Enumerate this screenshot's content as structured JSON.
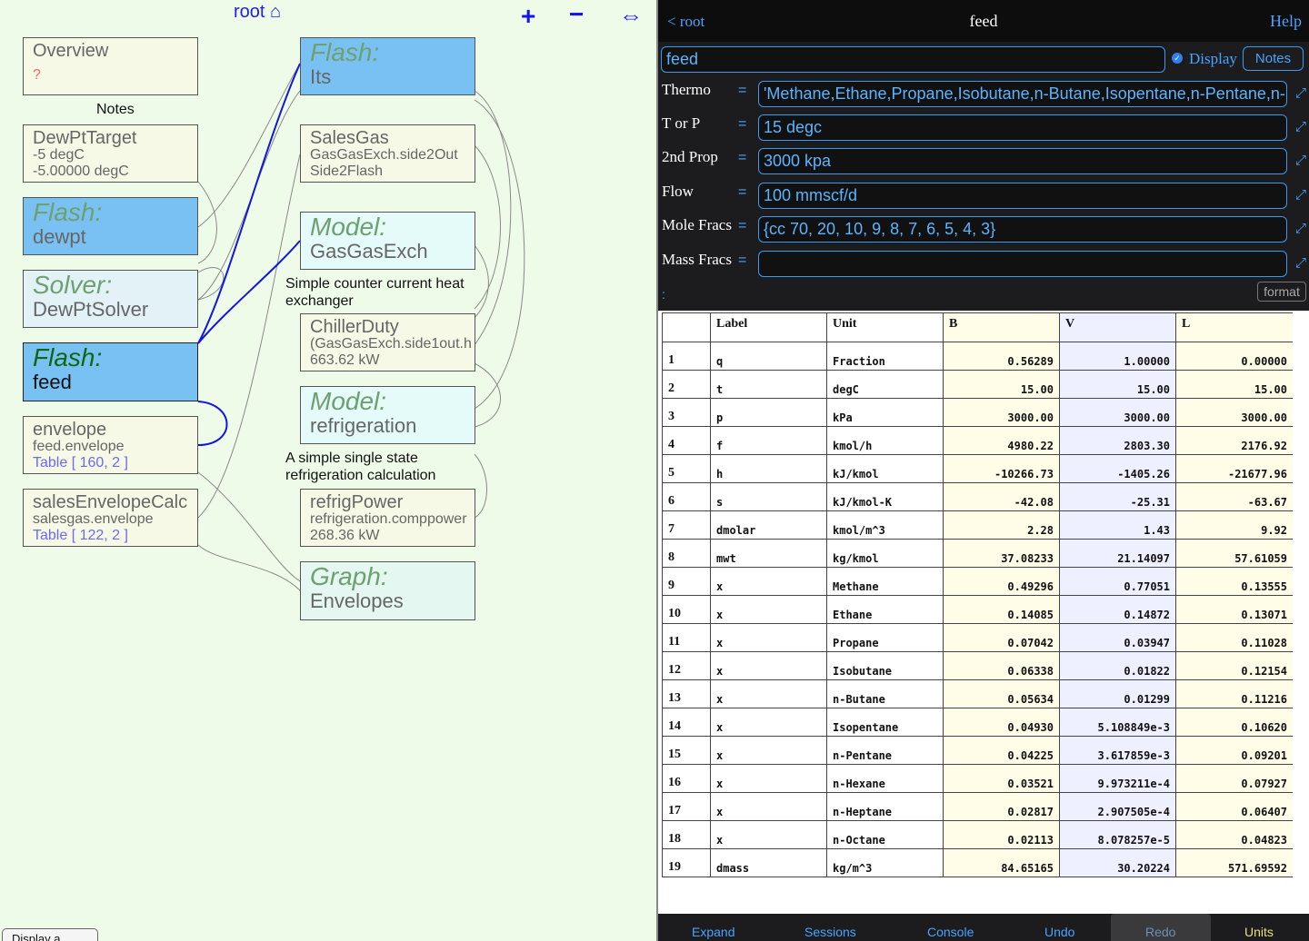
{
  "left_pane": {
    "root_link": "root ⌂",
    "buttons": {
      "add": "+",
      "remove": "−",
      "swap": "⇔"
    },
    "menu_tab": "Display a menu",
    "nodes": {
      "overview": {
        "title": "Overview",
        "sub": "?"
      },
      "dewpt_target": {
        "title": "DewPtTarget",
        "lines": [
          "-5 degC",
          "-5.00000 degC"
        ]
      },
      "flash_dewpt": {
        "type": "Flash:",
        "name": "dewpt"
      },
      "solver": {
        "type": "Solver:",
        "name": "DewPtSolver"
      },
      "flash_feed": {
        "type": "Flash:",
        "name": "feed"
      },
      "envelope": {
        "title": "envelope",
        "line1": "feed.envelope",
        "line2": "Table [ 160, 2 ]"
      },
      "sales_env": {
        "title": "salesEnvelopeCalc",
        "line1": "salesgas.envelope",
        "line2": "Table [ 122, 2 ]"
      },
      "flash_its": {
        "type": "Flash:",
        "name": "Its"
      },
      "sales_gas": {
        "title": "SalesGas",
        "lines": [
          "GasGasExch.side2Out",
          "Side2Flash"
        ]
      },
      "model_gge": {
        "type": "Model:",
        "name": "GasGasExch"
      },
      "chiller": {
        "title": "ChillerDuty",
        "lines": [
          "(GasGasExch.side1out.h",
          "663.62 kW"
        ]
      },
      "model_refrig": {
        "type": "Model:",
        "name": "refrigeration"
      },
      "refrig_power": {
        "title": "refrigPower",
        "lines": [
          "refrigeration.comppower",
          "268.36 kW"
        ]
      },
      "graph": {
        "type": "Graph:",
        "name": "Envelopes"
      }
    },
    "notes": {
      "overview_notes": "Notes",
      "gge_notes": "Simple counter current heat exchanger",
      "refrig_notes": "A simple single state refrigeration calculation"
    }
  },
  "right_pane": {
    "header": {
      "back": "< root",
      "title": "feed",
      "help": "Help"
    },
    "name_field": "feed",
    "display_label": "Display",
    "notes_button": "Notes",
    "format_button": "format",
    "colon": ":",
    "fields": [
      {
        "label": "Thermo",
        "value": "'Methane,Ethane,Propane,Isobutane,n-Butane,Isopentane,n-Pentane,n-Hexane,n-Heptane,n-Octane'"
      },
      {
        "label": "T or P",
        "value": "15 degc"
      },
      {
        "label": "2nd Prop",
        "value": "3000 kpa"
      },
      {
        "label": "Flow",
        "value": "100 mmscf/d"
      },
      {
        "label": "Mole Fracs",
        "value": "{cc 70, 20, 10, 9, 8, 7, 6, 5, 4, 3}"
      },
      {
        "label": "Mass Fracs",
        "value": ""
      }
    ],
    "table": {
      "headers": [
        "",
        "Label",
        "Unit",
        "B",
        "V",
        "L"
      ],
      "rows": [
        [
          "1",
          "q",
          "Fraction",
          "0.56289",
          "1.00000",
          "0.00000"
        ],
        [
          "2",
          "t",
          "degC",
          "15.00",
          "15.00",
          "15.00"
        ],
        [
          "3",
          "p",
          "kPa",
          "3000.00",
          "3000.00",
          "3000.00"
        ],
        [
          "4",
          "f",
          "kmol/h",
          "4980.22",
          "2803.30",
          "2176.92"
        ],
        [
          "5",
          "h",
          "kJ/kmol",
          "-10266.73",
          "-1405.26",
          "-21677.96"
        ],
        [
          "6",
          "s",
          "kJ/kmol-K",
          "-42.08",
          "-25.31",
          "-63.67"
        ],
        [
          "7",
          "dmolar",
          "kmol/m^3",
          "2.28",
          "1.43",
          "9.92"
        ],
        [
          "8",
          "mwt",
          "kg/kmol",
          "37.08233",
          "21.14097",
          "57.61059"
        ],
        [
          "9",
          "x",
          "Methane",
          "0.49296",
          "0.77051",
          "0.13555"
        ],
        [
          "10",
          "x",
          "Ethane",
          "0.14085",
          "0.14872",
          "0.13071"
        ],
        [
          "11",
          "x",
          "Propane",
          "0.07042",
          "0.03947",
          "0.11028"
        ],
        [
          "12",
          "x",
          "Isobutane",
          "0.06338",
          "0.01822",
          "0.12154"
        ],
        [
          "13",
          "x",
          "n-Butane",
          "0.05634",
          "0.01299",
          "0.11216"
        ],
        [
          "14",
          "x",
          "Isopentane",
          "0.04930",
          "5.108849e-3",
          "0.10620"
        ],
        [
          "15",
          "x",
          "n-Pentane",
          "0.04225",
          "3.617859e-3",
          "0.09201"
        ],
        [
          "16",
          "x",
          "n-Hexane",
          "0.03521",
          "9.973211e-4",
          "0.07927"
        ],
        [
          "17",
          "x",
          "n-Heptane",
          "0.02817",
          "2.907505e-4",
          "0.06407"
        ],
        [
          "18",
          "x",
          "n-Octane",
          "0.02113",
          "8.078257e-5",
          "0.04823"
        ],
        [
          "19",
          "dmass",
          "kg/m^3",
          "84.65165",
          "30.20224",
          "571.69592"
        ]
      ]
    },
    "tabs": [
      "Expand",
      "Sessions",
      "Console",
      "Undo",
      "Redo",
      "Units"
    ]
  }
}
